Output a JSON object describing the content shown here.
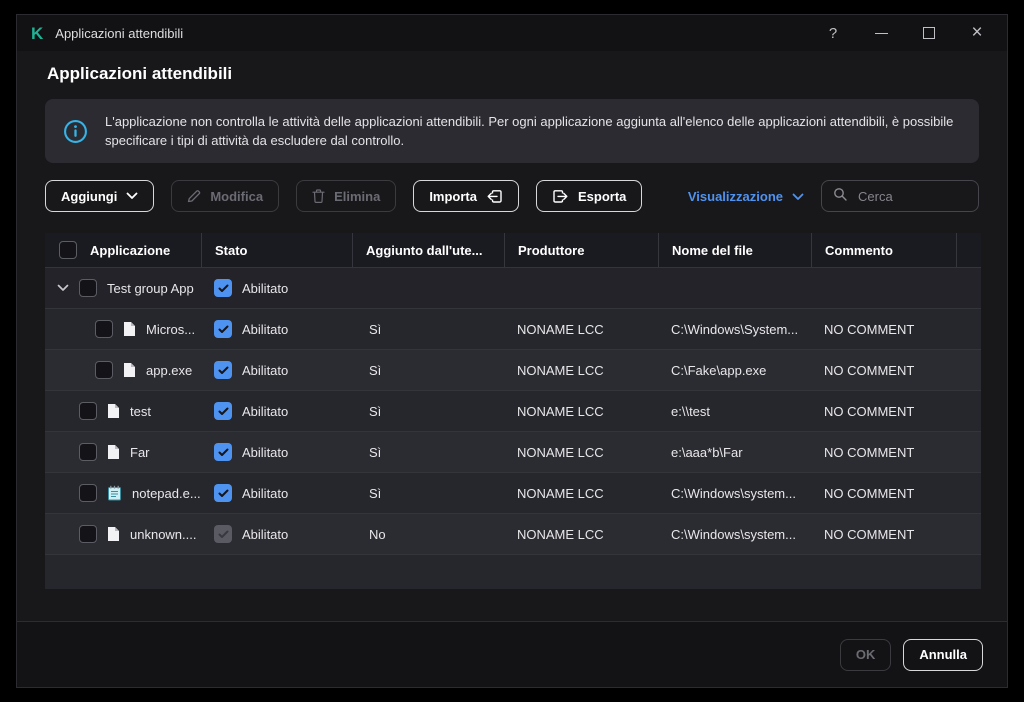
{
  "window": {
    "title": "Applicazioni attendibili",
    "controls": {
      "help": "?",
      "close": "×"
    }
  },
  "page": {
    "heading": "Applicazioni attendibili",
    "info_text": "L'applicazione non controlla le attività delle applicazioni attendibili. Per ogni applicazione aggiunta all'elenco delle applicazioni attendibili, è possibile specificare i tipi di attività da escludere dal controllo."
  },
  "toolbar": {
    "add_label": "Aggiungi",
    "edit_label": "Modifica",
    "delete_label": "Elimina",
    "import_label": "Importa",
    "export_label": "Esporta",
    "view_label": "Visualizzazione",
    "search_placeholder": "Cerca"
  },
  "table": {
    "headers": {
      "application": "Applicazione",
      "status": "Stato",
      "added_by": "Aggiunto dall'ute...",
      "vendor": "Produttore",
      "file": "Nome del file",
      "comment": "Commento"
    },
    "rows": [
      {
        "name": "Test group App",
        "status": "Abilitato",
        "added_by": "",
        "vendor": "",
        "file": "",
        "comment": "",
        "type": "group",
        "status_enabled": true
      },
      {
        "name": "Micros...",
        "status": "Abilitato",
        "added_by": "Sì",
        "vendor": "NONAME LCC",
        "file": "C:\\Windows\\System...",
        "comment": "NO COMMENT",
        "type": "file",
        "status_enabled": true
      },
      {
        "name": "app.exe",
        "status": "Abilitato",
        "added_by": "Sì",
        "vendor": "NONAME LCC",
        "file": "C:\\Fake\\app.exe",
        "comment": "NO COMMENT",
        "type": "file",
        "status_enabled": true
      },
      {
        "name": "test",
        "status": "Abilitato",
        "added_by": "Sì",
        "vendor": "NONAME LCC",
        "file": "e:\\\\test",
        "comment": "NO COMMENT",
        "type": "file",
        "status_enabled": true
      },
      {
        "name": "Far",
        "status": "Abilitato",
        "added_by": "Sì",
        "vendor": "NONAME LCC",
        "file": "e:\\aaa*b\\Far",
        "comment": "NO COMMENT",
        "type": "file",
        "status_enabled": true
      },
      {
        "name": "notepad.e...",
        "status": "Abilitato",
        "added_by": "Sì",
        "vendor": "NONAME LCC",
        "file": "C:\\Windows\\system...",
        "comment": "NO COMMENT",
        "type": "notepad",
        "status_enabled": true
      },
      {
        "name": "unknown....",
        "status": "Abilitato",
        "added_by": "No",
        "vendor": "NONAME LCC",
        "file": "C:\\Windows\\system...",
        "comment": "NO COMMENT",
        "type": "file",
        "status_enabled": false
      }
    ]
  },
  "footer": {
    "ok_label": "OK",
    "cancel_label": "Annulla"
  },
  "colors": {
    "accent_blue": "#4f93f0",
    "brand_teal": "#1fb394",
    "info_cyan": "#35b4e8",
    "row_dark": "#26262d",
    "row_light": "#2b2b32"
  }
}
